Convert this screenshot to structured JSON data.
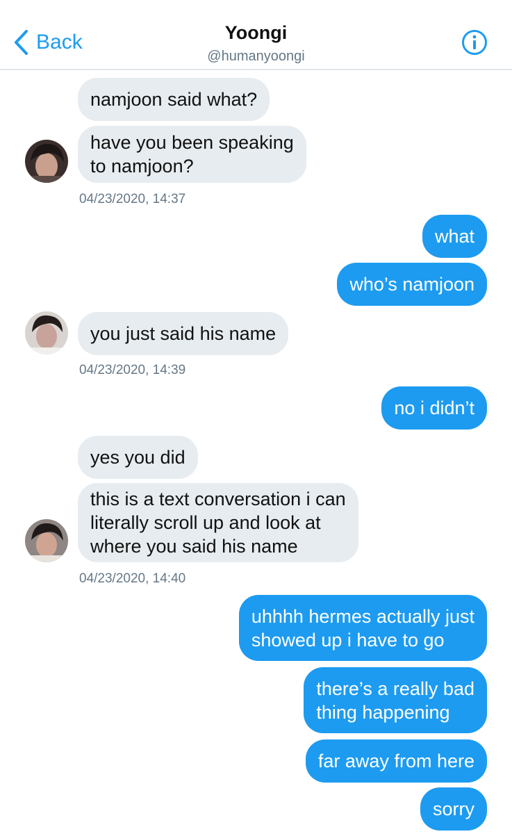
{
  "header": {
    "back_label": "Back",
    "title": "Yoongi",
    "handle": "@humanyoongi"
  },
  "messages": [
    {
      "text": "namjoon said what?"
    },
    {
      "text": "have you been speaking\nto namjoon?"
    },
    {
      "text": "04/23/2020, 14:37"
    },
    {
      "text": "what"
    },
    {
      "text": "who’s namjoon"
    },
    {
      "text": "you just said his name"
    },
    {
      "text": "04/23/2020, 14:39"
    },
    {
      "text": "no i didn’t"
    },
    {
      "text": "yes you did"
    },
    {
      "text": "this is a text conversation i can\nliterally scroll up and look at\nwhere you said his name"
    },
    {
      "text": "04/23/2020, 14:40"
    },
    {
      "text": "uhhhh hermes actually just\nshowed up i have to go"
    },
    {
      "text": "there’s a really bad\nthing happening"
    },
    {
      "text": "far away from here"
    },
    {
      "text": "sorry"
    }
  ],
  "colors": {
    "accent": "#1d9bf0",
    "incoming_bubble": "#e6ecf0",
    "timestamp": "#657786"
  },
  "icons": [
    "chevron-left-icon",
    "info-icon",
    "avatar"
  ]
}
